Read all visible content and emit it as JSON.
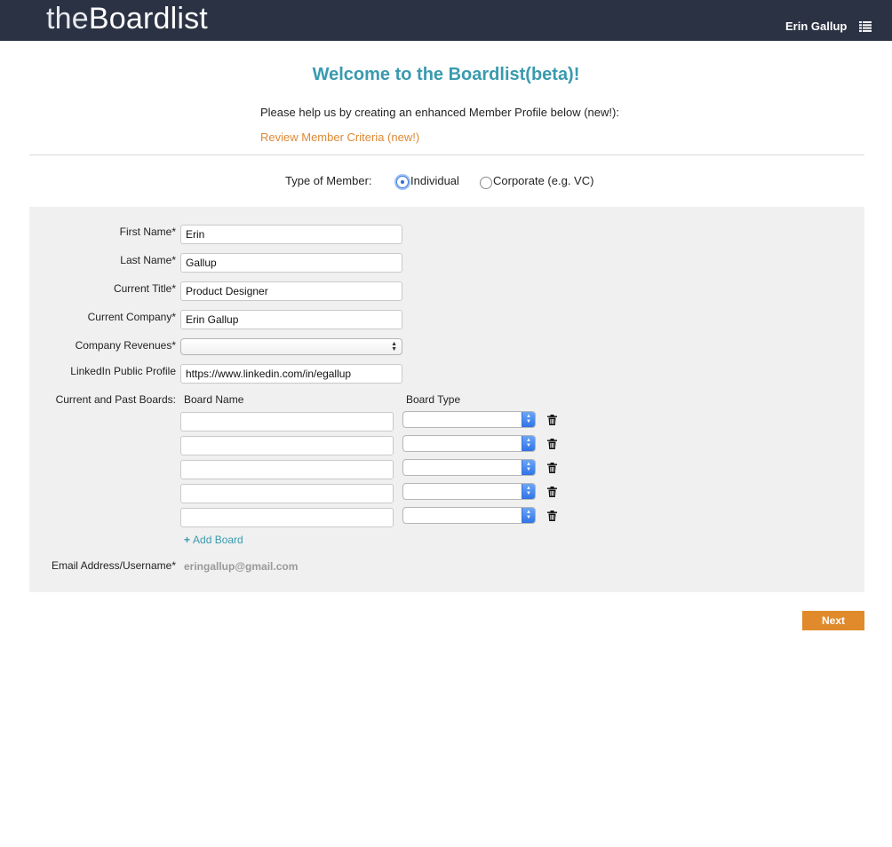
{
  "header": {
    "logo_prefix": "the",
    "logo_brand": "Boardlist",
    "user_name": "Erin Gallup",
    "menu_icon": "list-icon"
  },
  "intro": {
    "welcome": "Welcome to the Boardlist(beta)!",
    "help_text": "Please help us by creating an enhanced Member Profile below (new!):",
    "criteria_link": "Review Member Criteria (new!)"
  },
  "member_type": {
    "label": "Type of Member:",
    "options": [
      "Individual",
      "Corporate (e.g. VC)"
    ],
    "selected": "Individual"
  },
  "form": {
    "first_name": {
      "label": "First Name*",
      "value": "Erin"
    },
    "last_name": {
      "label": "Last Name*",
      "value": "Gallup"
    },
    "current_title": {
      "label": "Current Title*",
      "value": "Product Designer"
    },
    "current_company": {
      "label": "Current Company*",
      "value": "Erin Gallup"
    },
    "company_revenues": {
      "label": "Company Revenues*",
      "value": ""
    },
    "linkedin": {
      "label": "LinkedIn Public Profile",
      "value": "https://www.linkedin.com/in/egallup"
    },
    "boards": {
      "label": "Current and Past Boards:",
      "col_name": "Board Name",
      "col_type": "Board Type",
      "rows": [
        {
          "name": "",
          "type": ""
        },
        {
          "name": "",
          "type": ""
        },
        {
          "name": "",
          "type": ""
        },
        {
          "name": "",
          "type": ""
        },
        {
          "name": "",
          "type": ""
        }
      ],
      "add_label": "Add Board"
    },
    "email": {
      "label": "Email Address/Username*",
      "value": "eringallup@gmail.com"
    }
  },
  "actions": {
    "next_label": "Next"
  },
  "colors": {
    "header_bg": "#2b3243",
    "heading": "#3a9aaf",
    "link": "#dd8a33",
    "panel_bg": "#f0f0f0",
    "button": "#e08a2c"
  }
}
